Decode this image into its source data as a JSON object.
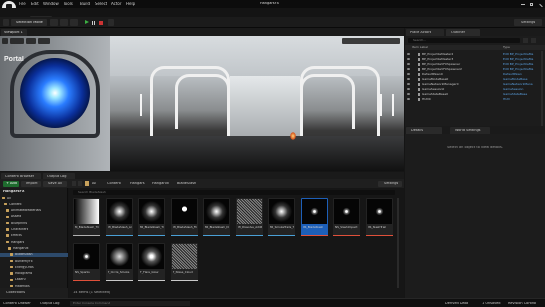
{
  "window": {
    "tab_label": "Stage0-Sub1",
    "project_name": "HangarsFX",
    "settings_label": "Settings"
  },
  "menu": [
    "File",
    "Edit",
    "Window",
    "Tools",
    "Build",
    "Select",
    "Actor",
    "Help"
  ],
  "toolbar": {
    "mode_label": "Selection Mode"
  },
  "viewport": {
    "tab_label": "Viewport 1",
    "portal_text": "Portal"
  },
  "outliner": {
    "tabs": [
      "Place Actors",
      "Outliner"
    ],
    "search_placeholder": "Search...",
    "column_label": "Item Label",
    "column_type": "Type",
    "rows": [
      {
        "label": "BP_ProjectileMaster2",
        "type": "Edit BP_ProjectileMa",
        "selected": false
      },
      {
        "label": "BP_ProjectileMaster3",
        "type": "Edit BP_ProjectileMa",
        "selected": false
      },
      {
        "label": "BP_ProjectileVFXSpawner",
        "type": "Edit BP_ProjectileMa",
        "selected": false
      },
      {
        "label": "BP_ProjectileVFXSpawner2",
        "type": "Edit BP_ProjectileMa",
        "selected": false
      },
      {
        "label": "DefaultPawn0",
        "type": "DefaultPawn",
        "selected": false
      },
      {
        "label": "GameModeBase0",
        "type": "GameModeBase",
        "selected": false
      },
      {
        "label": "GameNetworkManager0",
        "type": "GameNetworkMana",
        "selected": false
      },
      {
        "label": "GameSession0",
        "type": "GameSession",
        "selected": false
      },
      {
        "label": "GameStateBase0",
        "type": "GameStateBase",
        "selected": false
      },
      {
        "label": "HUD0",
        "type": "HUD",
        "selected": false
      }
    ],
    "footer": "96 actors"
  },
  "details": {
    "tabs": [
      "Details",
      "World Settings"
    ],
    "empty_message": "Select an object to view details."
  },
  "content_browser": {
    "tabs": [
      "Content Browser",
      "Output Log"
    ],
    "add_label": "+ Add",
    "import_label": "Import",
    "save_all_label": "Save All",
    "breadcrumb": [
      "All",
      "Content",
      "Hangars",
      "Hangar0k",
      "BladeSlash"
    ],
    "settings_label": "Settings",
    "search_placeholder": "Search BladeSlash",
    "tree_root": "HangarsFX",
    "tree": [
      {
        "label": "All",
        "selected": false
      },
      {
        "label": "Content",
        "selected": false
      },
      {
        "label": "AnimatedMaterials",
        "selected": false
      },
      {
        "label": "Assets",
        "selected": false
      },
      {
        "label": "Blueprints",
        "selected": false
      },
      {
        "label": "Characters",
        "selected": false
      },
      {
        "label": "Effects",
        "selected": false
      },
      {
        "label": "Hangars",
        "selected": false
      },
      {
        "label": "Hangar0k",
        "selected": false
      },
      {
        "label": "BladeSlash",
        "selected": true
      },
      {
        "label": "ButterflyFx",
        "selected": false
      },
      {
        "label": "EnergyOrbs",
        "selected": false
      },
      {
        "label": "Holograms",
        "selected": false
      },
      {
        "label": "Laser0",
        "selected": false
      },
      {
        "label": "Materials",
        "selected": false
      }
    ],
    "assets": [
      {
        "name": "M_BladeSlash_Tile",
        "selected": false,
        "bar": "#b0b0b0"
      },
      {
        "name": "MI_BladeSlash_Additive",
        "selected": false,
        "bar": "#4aa0d6"
      },
      {
        "name": "MI_BladeSlash_Trans",
        "selected": false,
        "bar": "#4aa0d6"
      },
      {
        "name": "MI_BladeSlash_Flipbook",
        "selected": false,
        "bar": "#4aa0d6"
      },
      {
        "name": "MI_BladeSlash_Distort",
        "selected": false,
        "bar": "#4aa0d6"
      },
      {
        "name": "MI_Dissolve_Additive",
        "selected": false,
        "bar": "#4aa0d6"
      },
      {
        "name": "MI_SmokeTrails_Trans",
        "selected": false,
        "bar": "#4aa0d6"
      },
      {
        "name": "NS_BladeSlash",
        "selected": true,
        "bar": "#e0503a"
      },
      {
        "name": "NS_SlashImpact",
        "selected": false,
        "bar": "#e0503a"
      },
      {
        "name": "NS_SlashTrail",
        "selected": false,
        "bar": "#e0503a"
      },
      {
        "name": "NS_Sparks",
        "selected": false,
        "bar": "#e0503a"
      },
      {
        "name": "T_Circle_Smoke",
        "selected": false,
        "bar": "#c9c9c9"
      },
      {
        "name": "T_Flare_Glow",
        "selected": false,
        "bar": "#c9c9c9"
      },
      {
        "name": "T_Noise_Cloud",
        "selected": false,
        "bar": "#c9c9c9"
      }
    ],
    "status": "14 items (1 selected)",
    "collections_label": "Collections"
  },
  "statusbar": {
    "content_drawer": "Content Drawer",
    "output_log": "Output Log",
    "cmd_placeholder": "Enter Console Command",
    "derived_data": "Derived Data",
    "unsaved": "1 Unsaved",
    "revision": "Revision Control"
  }
}
